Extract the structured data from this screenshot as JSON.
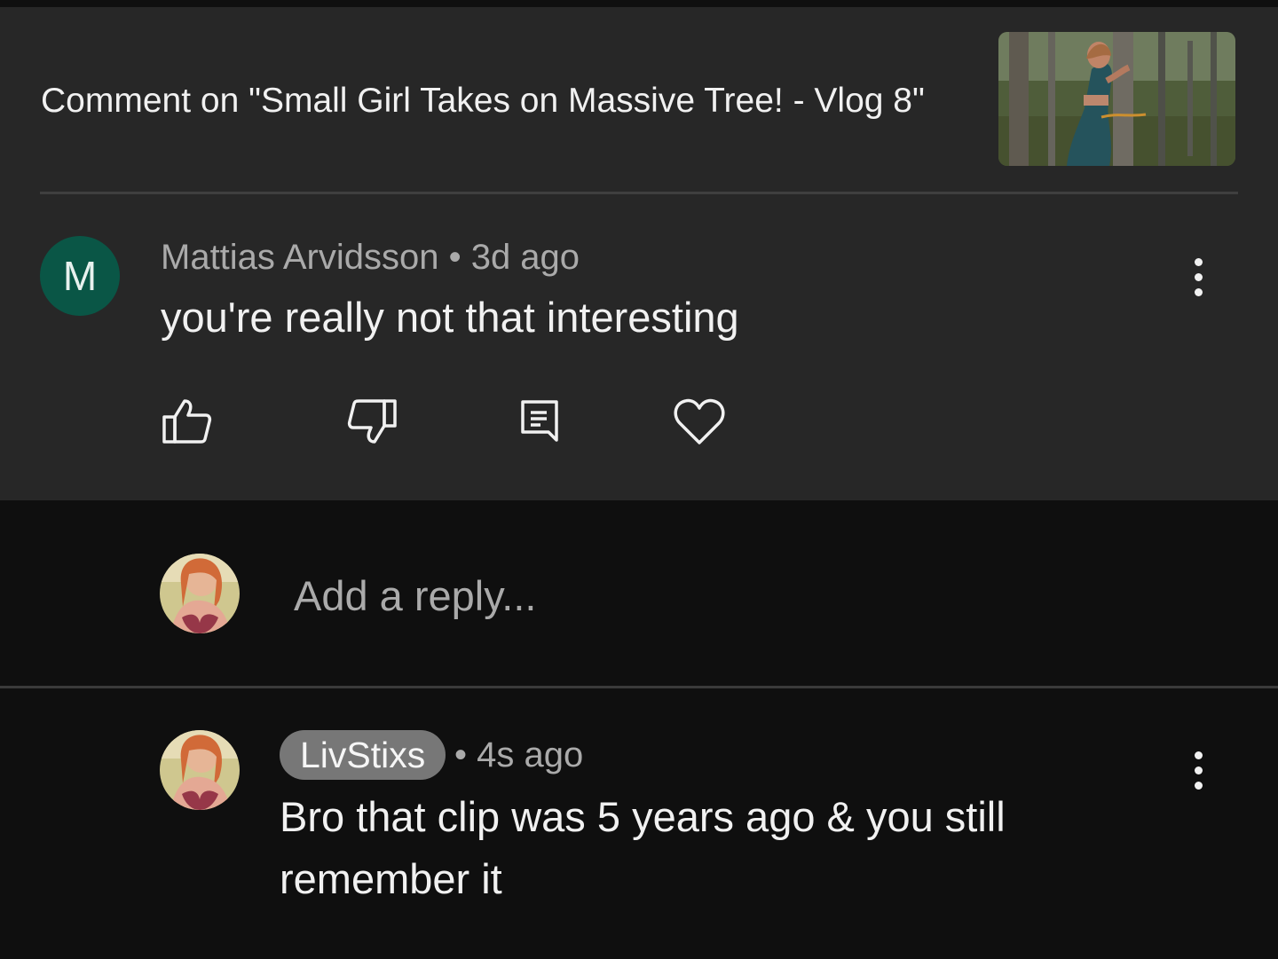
{
  "header": {
    "title": "Comment on \"Small Girl Takes on Massive Tree! - Vlog 8\""
  },
  "comment": {
    "avatar_letter": "M",
    "author": "Mattias Arvidsson",
    "separator": " • ",
    "time": "3d ago",
    "text": "you're really not that interesting",
    "actions": [
      "like-icon",
      "dislike-icon",
      "reply-icon",
      "heart-icon"
    ],
    "more_icon": "more-vert-icon"
  },
  "reply_box": {
    "placeholder": "Add a reply..."
  },
  "reply": {
    "author": "LivStixs",
    "meta": "• 4s ago",
    "text": "Bro that clip was 5 years ago & you still remember it",
    "more_icon": "more-vert-icon"
  },
  "colors": {
    "card_bg": "#272727",
    "page_bg": "#0f0f0f",
    "avatar_bg": "#0a5646",
    "pill_bg": "#777777",
    "secondary_text": "#aaaaaa"
  }
}
